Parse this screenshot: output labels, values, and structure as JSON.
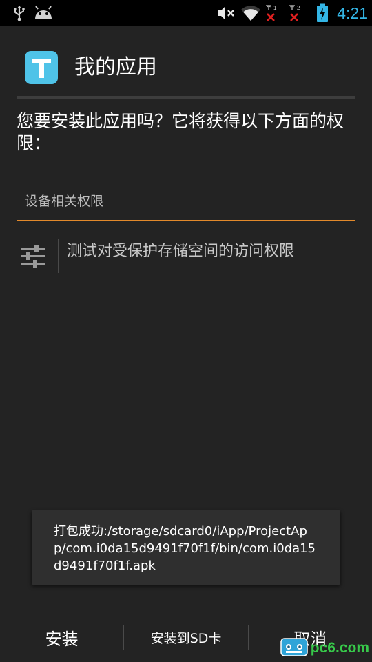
{
  "status_bar": {
    "time": "4:21",
    "sim1_label": "1",
    "sim2_label": "2",
    "icons": [
      "usb-icon",
      "android-icon",
      "mute-icon",
      "wifi-icon",
      "sim1-no-signal-icon",
      "sim2-no-signal-icon",
      "battery-charging-icon"
    ],
    "clock_color": "#33b5e5"
  },
  "header": {
    "title": "我的应用",
    "icon_color": "#4fc3e8"
  },
  "prompt": "您要安装此应用吗？它将获得以下方面的权限：",
  "section": {
    "title": "设备相关权限",
    "accent": "#e2892b"
  },
  "permissions": [
    {
      "label": "测试对受保护存储空间的访问权限",
      "icon": "settings-sliders-icon"
    }
  ],
  "toast": {
    "text": "打包成功:/storage/sdcard0/iApp/ProjectApp/com.i0da15d9491f70f1f/bin/com.i0da15d9491f70f1f.apk"
  },
  "buttons": {
    "install": "安装",
    "install_sd": "安装到SD卡",
    "cancel": "取消"
  },
  "watermark": {
    "text": "pc6.com"
  }
}
